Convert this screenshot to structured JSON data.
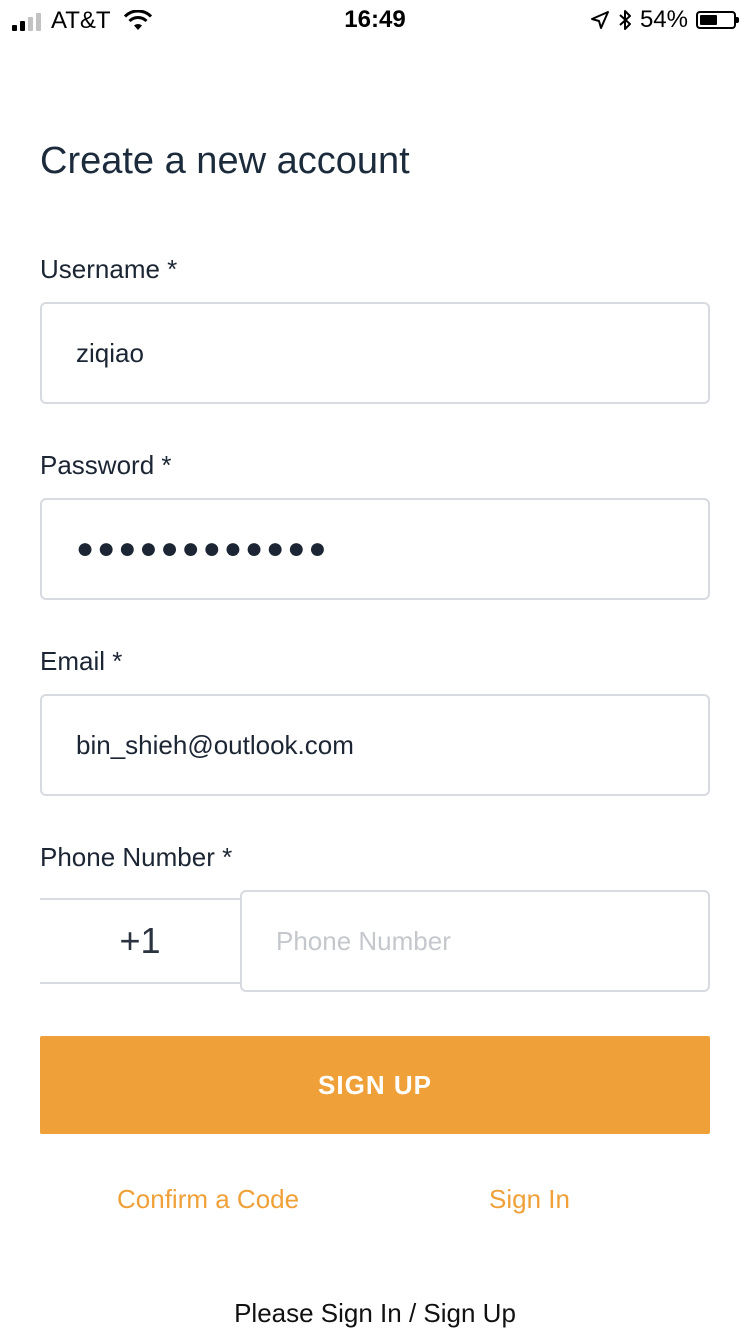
{
  "status_bar": {
    "carrier": "AT&T",
    "time": "16:49",
    "battery_percent": "54%",
    "battery_level": 0.54,
    "signal_bars_filled": 2,
    "signal_bars_total": 4,
    "icons": [
      "signal-icon",
      "wifi-icon",
      "location-arrow-icon",
      "bluetooth-icon",
      "battery-icon"
    ]
  },
  "form": {
    "title": "Create a new account",
    "username": {
      "label": "Username *",
      "value": "ziqiao"
    },
    "password": {
      "label": "Password *",
      "value": "●●●●●●●●●●●●"
    },
    "email": {
      "label": "Email *",
      "value": "bin_shieh@outlook.com"
    },
    "phone": {
      "label": "Phone Number *",
      "dial_code": "+1",
      "placeholder": "Phone Number",
      "value": ""
    },
    "submit_label": "SIGN UP"
  },
  "links": {
    "confirm_code": "Confirm a Code",
    "sign_in": "Sign In"
  },
  "footer": {
    "text": "Please Sign In / Sign Up"
  },
  "colors": {
    "accent": "#f0a038",
    "border": "#d7dbe0",
    "title_text": "#1b2b3c"
  }
}
